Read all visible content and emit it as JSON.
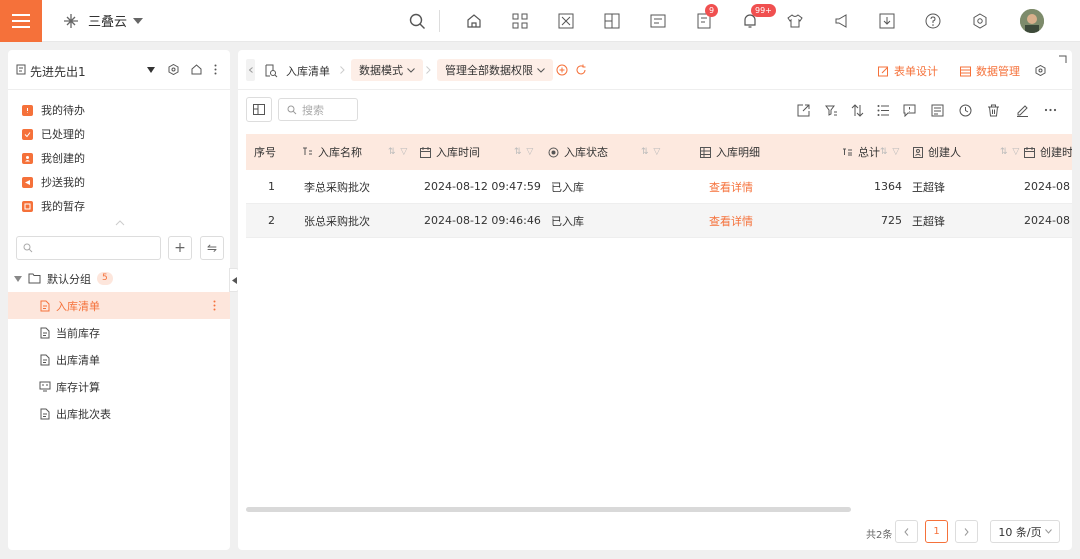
{
  "topbar": {
    "brand": "三叠云",
    "badges": {
      "tasks": "9",
      "notifications": "99+"
    },
    "accent": "#f5713a"
  },
  "sidebar": {
    "workspace": "先进先出1",
    "quick_items": [
      {
        "label": "我的待办",
        "icon": "todo-icon"
      },
      {
        "label": "已处理的",
        "icon": "check-icon"
      },
      {
        "label": "我创建的",
        "icon": "user-icon"
      },
      {
        "label": "抄送我的",
        "icon": "send-icon"
      },
      {
        "label": "我的暂存",
        "icon": "save-icon"
      }
    ],
    "group": {
      "label": "默认分组",
      "count": "5"
    },
    "tree": [
      {
        "label": "入库清单",
        "active": true
      },
      {
        "label": "当前库存"
      },
      {
        "label": "出库清单"
      },
      {
        "label": "库存计算"
      },
      {
        "label": "出库批次表"
      }
    ]
  },
  "main": {
    "breadcrumb": {
      "page": "入库清单",
      "mode": "数据模式",
      "permission": "管理全部数据权限"
    },
    "actions": {
      "form_design": "表单设计",
      "data_manage": "数据管理"
    },
    "search_placeholder": "搜索",
    "columns": {
      "index": "序号",
      "name": "入库名称",
      "time": "入库时间",
      "status": "入库状态",
      "detail": "入库明细",
      "total": "总计",
      "creator": "创建人",
      "created": "创建时"
    },
    "rows": [
      {
        "index": "1",
        "name": "李总采购批次",
        "time": "2024-08-12 09:47:59",
        "status": "已入库",
        "detail": "查看详情",
        "total": "1364",
        "creator": "王超锋",
        "created": "2024-08"
      },
      {
        "index": "2",
        "name": "张总采购批次",
        "time": "2024-08-12 09:46:46",
        "status": "已入库",
        "detail": "查看详情",
        "total": "725",
        "creator": "王超锋",
        "created": "2024-08"
      }
    ],
    "pager": {
      "total": "共2条",
      "current": "1",
      "page_size": "10 条/页"
    }
  }
}
